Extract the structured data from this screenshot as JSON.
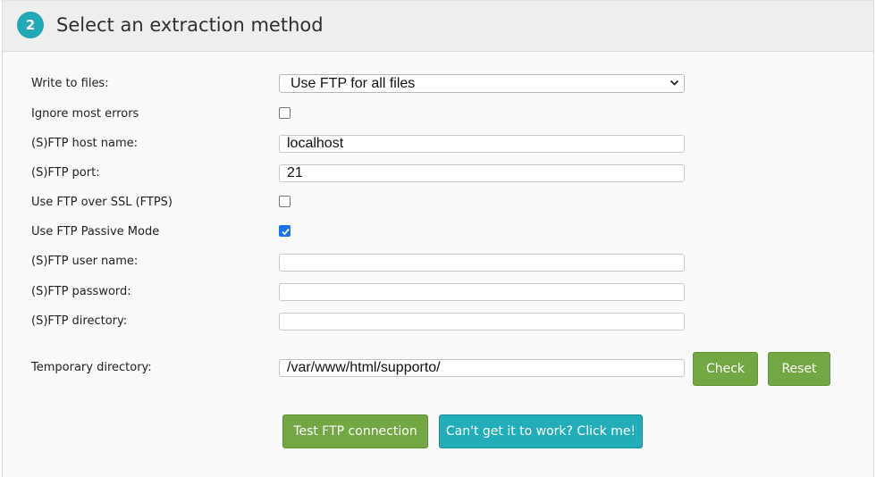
{
  "header": {
    "step_number": "2",
    "title": "Select an extraction method"
  },
  "form": {
    "write_to_files": {
      "label": "Write to files:",
      "selected": "Use FTP for all files"
    },
    "ignore_errors": {
      "label": "Ignore most errors",
      "checked": false
    },
    "ftp_host": {
      "label": "(S)FTP host name:",
      "value": "localhost"
    },
    "ftp_port": {
      "label": "(S)FTP port:",
      "value": "21"
    },
    "ftps": {
      "label": "Use FTP over SSL (FTPS)",
      "checked": false
    },
    "passive_mode": {
      "label": "Use FTP Passive Mode",
      "checked": true
    },
    "ftp_user": {
      "label": "(S)FTP user name:",
      "value": ""
    },
    "ftp_password": {
      "label": "(S)FTP password:",
      "value": ""
    },
    "ftp_directory": {
      "label": "(S)FTP directory:",
      "value": ""
    },
    "temp_directory": {
      "label": "Temporary directory:",
      "value": "/var/www/html/supporto/"
    }
  },
  "buttons": {
    "check": "Check",
    "reset": "Reset",
    "test_ftp": "Test FTP connection",
    "help": "Can't get it to work? Click me!"
  },
  "colors": {
    "accent_teal": "#23a8b5",
    "button_green": "#72a744",
    "checkbox_blue": "#1a73e8"
  },
  "icons": {
    "select_arrow": "chevron-down-icon",
    "checkmark": "checkmark-icon"
  }
}
